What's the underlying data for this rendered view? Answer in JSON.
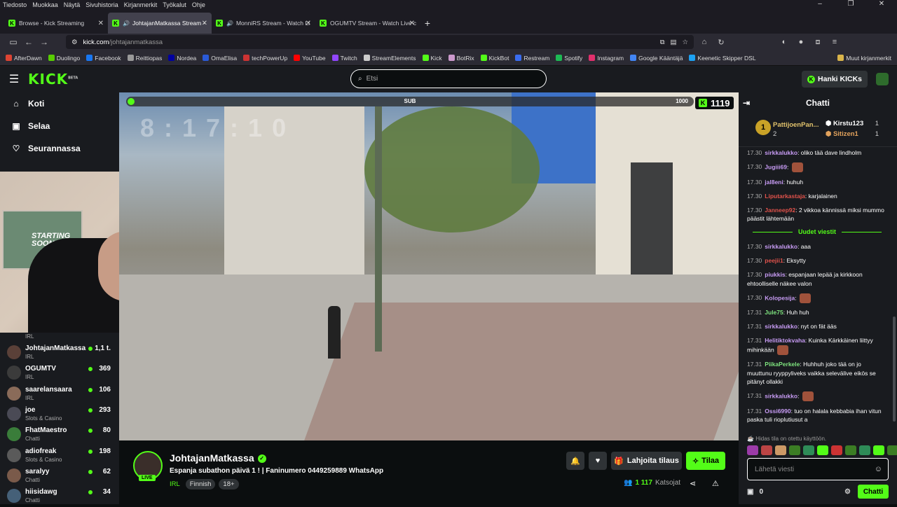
{
  "menu": [
    "Tiedosto",
    "Muokkaa",
    "Näytä",
    "Sivuhistoria",
    "Kirjanmerkit",
    "Työkalut",
    "Ohje"
  ],
  "tabs": [
    {
      "label": "Browse - Kick Streaming"
    },
    {
      "label": "JohtajanMatkassa Stream -"
    },
    {
      "label": "MonniRS Stream - Watch Li"
    },
    {
      "label": "OGUMTV Stream - Watch Live c"
    }
  ],
  "url": {
    "host": "kick.com",
    "path": "/johtajanmatkassa"
  },
  "bookmarks": [
    {
      "label": "AfterDawn",
      "color": "#d43"
    },
    {
      "label": "Duolingo",
      "color": "#58cc02"
    },
    {
      "label": "Facebook",
      "color": "#1877f2"
    },
    {
      "label": "Reittiopas",
      "color": "#999"
    },
    {
      "label": "Nordea",
      "color": "#0000a0"
    },
    {
      "label": "OmaElisa",
      "color": "#2a5ad7"
    },
    {
      "label": "techPowerUp",
      "color": "#c33"
    },
    {
      "label": "YouTube",
      "color": "#f00"
    },
    {
      "label": "Twitch",
      "color": "#9146ff"
    },
    {
      "label": "StreamElements",
      "color": "#ccc"
    },
    {
      "label": "Kick",
      "color": "#53fc18"
    },
    {
      "label": "BotRix",
      "color": "#c9c"
    },
    {
      "label": "KickBot",
      "color": "#53fc18"
    },
    {
      "label": "Restream",
      "color": "#3a6df0"
    },
    {
      "label": "Spotify",
      "color": "#1db954"
    },
    {
      "label": "Instagram",
      "color": "#e1306c"
    },
    {
      "label": "Google Kääntäjä",
      "color": "#4285f4"
    },
    {
      "label": "Keenetic Skipper DSL",
      "color": "#1da1f2"
    }
  ],
  "bookmarks_other": "Muut kirjanmerkit",
  "header": {
    "logo": "KICK",
    "logo_sup": "BETA",
    "search_placeholder": "Etsi",
    "kicks_button": "Hanki KICKs"
  },
  "sidebar": {
    "nav": [
      {
        "label": "Koti",
        "icon": "home-icon"
      },
      {
        "label": "Selaa",
        "icon": "browse-icon"
      },
      {
        "label": "Seurannassa",
        "icon": "heart-icon"
      }
    ],
    "partial_category": "IRL",
    "streams": [
      {
        "name": "JohtajanMatkassa",
        "category": "IRL",
        "viewers": "1,1 t."
      },
      {
        "name": "OGUMTV",
        "category": "IRL",
        "viewers": "369"
      },
      {
        "name": "saarelansaara",
        "category": "IRL",
        "viewers": "106"
      },
      {
        "name": "joe",
        "category": "Slots & Casino",
        "viewers": "293"
      },
      {
        "name": "FhatMaestro",
        "category": "Chatti",
        "viewers": "80"
      },
      {
        "name": "adiofreak",
        "category": "Slots & Casino",
        "viewers": "198"
      },
      {
        "name": "saralyy",
        "category": "Chatti",
        "viewers": "62"
      },
      {
        "name": "hiisidawg",
        "category": "Chatti",
        "viewers": "34"
      }
    ]
  },
  "webcam": {
    "poster_text": "STARTING SOON"
  },
  "video": {
    "sub_label": "SUB",
    "sub_max": "1000",
    "sub_progress": 0.0,
    "kick_count": "1119",
    "overlay_time": "8:17:10"
  },
  "channel": {
    "name": "JohtajanMatkassa",
    "live": "LIVE",
    "title": "Espanja subathon päivä 1 ! | Faninumero 0449259889 WhatsApp",
    "category": "IRL",
    "tags": [
      "Finnish",
      "18+"
    ],
    "gift_button": "Lahjoita tilaus",
    "sub_button": "Tilaa",
    "viewers_count": "1 117",
    "viewers_label": "Katsojat"
  },
  "chat": {
    "title": "Chatti",
    "gifters": {
      "top": {
        "rank": "1",
        "name": "PattijoenPan...",
        "count": "2"
      },
      "second": {
        "name": "Kirstu123",
        "count": "1"
      },
      "third": {
        "name": "Sitizen1",
        "count": "1"
      }
    },
    "messages_before": [
      {
        "time": "17.30",
        "user": "sirkkalukko",
        "color": "#c89cf5",
        "text": ": oliko tää dave lindholm"
      },
      {
        "time": "17.30",
        "user": "Jugiii69",
        "color": "#c89cf5",
        "text": ":",
        "emote": true
      },
      {
        "time": "17.30",
        "user": "jal8eni",
        "color": "#c89cf5",
        "text": ": huhuh"
      },
      {
        "time": "17.30",
        "user": "Liputarkastaja",
        "color": "#e0524b",
        "text": ": karjalainen"
      },
      {
        "time": "17.30",
        "user": "Janneep92",
        "color": "#e0524b",
        "text": ": 2 vikkoa kännissä miksi mummo päästit lähtemään"
      }
    ],
    "new_messages": "Uudet viestit",
    "messages_after": [
      {
        "time": "17.30",
        "user": "sirkkalukko",
        "color": "#c89cf5",
        "text": ": aaa"
      },
      {
        "time": "17.30",
        "user": "peejii1",
        "color": "#e0524b",
        "text": ": Eksytty"
      },
      {
        "time": "17.30",
        "user": "piukkis",
        "color": "#c89cf5",
        "text": ": espanjaan lepää ja kirkkoon ehtoolliselle näkee valon"
      },
      {
        "time": "17.30",
        "user": "Kolopesija",
        "color": "#c89cf5",
        "text": ":",
        "emote": true
      },
      {
        "time": "17.31",
        "user": "Jule75",
        "color": "#7ee37e",
        "text": ": Huh huh"
      },
      {
        "time": "17.31",
        "user": "sirkkalukko",
        "color": "#c89cf5",
        "text": ": nyt on fät ääs"
      },
      {
        "time": "17.31",
        "user": "Helitiktokvaha",
        "color": "#c89cf5",
        "text": ": Kuinka Kärkkäinen liittyy mihinkään",
        "emote": true
      },
      {
        "time": "17.31",
        "user": "PiikaPerkele",
        "color": "#7ee37e",
        "text": ": Huhhuh joko tää on jo muuttunu ryyppyliveks vaikka selevälive eikös se pitänyt ollakki"
      },
      {
        "time": "17.31",
        "user": "sirkkalukko",
        "color": "#c89cf5",
        "text": ":",
        "emote": true
      },
      {
        "time": "17.31",
        "user": "Ossi6990",
        "color": "#c89cf5",
        "text": ": tuo on halala kebbabia ihan vitun paska tuli rioplutiusut a"
      }
    ],
    "slow_mode": "Hidas tila on otettu käyttöön.",
    "input_placeholder": "Lähetä viesti",
    "kicks_balance": "0",
    "send_button": "Chatti"
  },
  "colors": {
    "accent": "#53fc18",
    "bg": "#0b0e0f",
    "panel": "#191b1f"
  }
}
